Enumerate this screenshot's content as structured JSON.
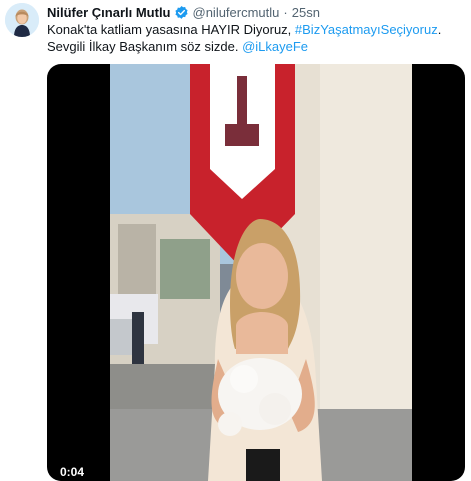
{
  "tweet": {
    "author": {
      "display_name": "Nilüfer Çınarlı Mutlu",
      "handle": "@nilufercmutlu",
      "verified_icon": "verified-badge-icon",
      "avatar": "avatar"
    },
    "separator": "·",
    "timestamp": "25sn",
    "text": {
      "line1_prefix": "Konak'ta katliam yasasına HAYIR Diyoruz, ",
      "hashtag": "#BizYaşatmayıSeçiyoruz",
      "line1_suffix": ".",
      "line2_prefix": "Sevgili İlkay Başkanım söz sizde. ",
      "mention": "@iLkayeFe"
    },
    "media": {
      "type": "video",
      "duration": "0:04"
    }
  },
  "colors": {
    "link": "#1d9bf0",
    "text": "#0f1419",
    "secondary": "#536471",
    "verified": "#1d9bf0",
    "media_background": "#000000"
  }
}
